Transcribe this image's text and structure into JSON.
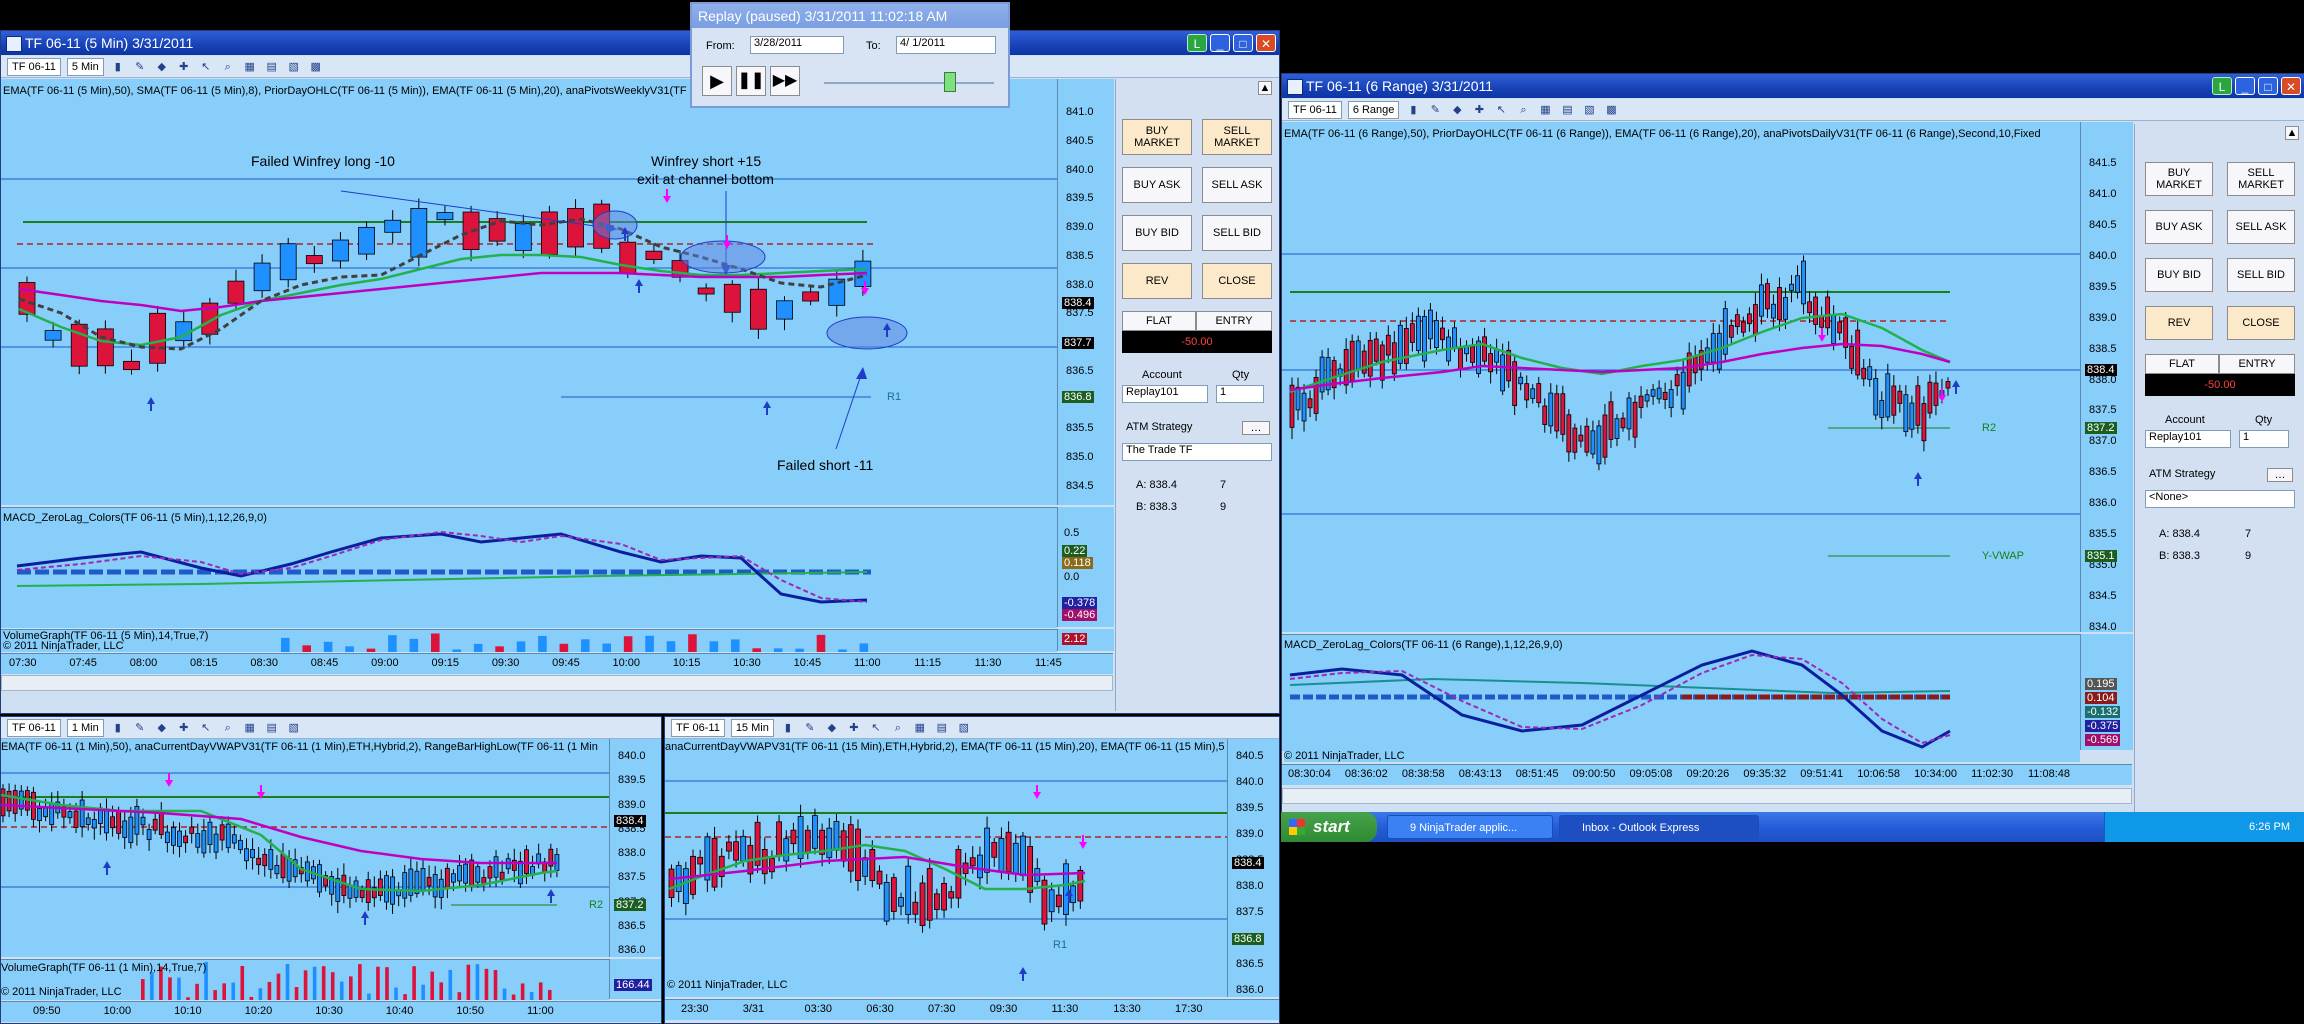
{
  "replay": {
    "title": "Replay (paused) 3/31/2011 11:02:18 AM",
    "from_label": "From:",
    "from_value": "3/28/2011",
    "to_label": "To:",
    "to_value": "4/ 1/2011"
  },
  "w1": {
    "title": "TF 06-11 (5 Min)  3/31/2011",
    "instrument": "TF 06-11",
    "period": "5 Min",
    "indicators": "EMA(TF 06-11 (5 Min),50), SMA(TF 06-11 (5 Min),8), PriorDayOHLC(TF 06-11 (5 Min)), EMA(TF 06-11 (5 Min),20), anaPivotsWeeklyV31(TF",
    "ann_failed_long": "Failed Winfrey long -10",
    "ann_short_1": "Winfrey short +15",
    "ann_short_2": "exit at channel bottom",
    "ann_failed_short": "Failed short -11",
    "r1": "R1",
    "price_ticks": [
      "841.0",
      "840.5",
      "840.0",
      "839.5",
      "839.0",
      "838.5",
      "838.0",
      "837.5",
      "837.0",
      "836.5",
      "836.0",
      "835.5",
      "835.0",
      "834.5"
    ],
    "price_boxes": [
      "838.4",
      "837.7",
      "836.8"
    ],
    "macd_label": "MACD_ZeroLag_Colors(TF 06-11 (5 Min),1,12,26,9,0)",
    "macd_ticks": [
      "0.5",
      "0.22",
      "0.118",
      "0.0",
      "-0.378",
      "-0.496"
    ],
    "volume_label": "VolumeGraph(TF 06-11 (5 Min),14,True,7)",
    "copyright": "© 2011 NinjaTrader, LLC",
    "vol_box": "2.12",
    "time_ticks": [
      "07:30",
      "07:45",
      "08:00",
      "08:15",
      "08:30",
      "08:45",
      "09:00",
      "09:15",
      "09:30",
      "09:45",
      "10:00",
      "10:15",
      "10:30",
      "10:45",
      "11:00",
      "11:15",
      "11:30",
      "11:45"
    ]
  },
  "w2": {
    "title": "TF 06-11 (6 Range)  3/31/2011",
    "instrument": "TF 06-11",
    "period": "6 Range",
    "indicators": "EMA(TF 06-11 (6 Range),50), PriorDayOHLC(TF 06-11 (6 Range)), EMA(TF 06-11 (6 Range),20), anaPivotsDailyV31(TF 06-11 (6 Range),Second,10,Fixed",
    "r2": "R2",
    "yvwap": "Y-VWAP",
    "price_ticks": [
      "841.5",
      "841.0",
      "840.5",
      "840.0",
      "839.5",
      "839.0",
      "838.5",
      "838.0",
      "837.5",
      "837.0",
      "836.5",
      "836.0",
      "835.5",
      "835.0",
      "834.5",
      "834.0"
    ],
    "price_boxes": [
      "838.4",
      "837.2",
      "835.1"
    ],
    "macd_label": "MACD_ZeroLag_Colors(TF 06-11 (6 Range),1,12,26,9,0)",
    "macd_ticks": [
      "0.195",
      "0.104",
      "-0.132",
      "-0.375",
      "-0.569"
    ],
    "copyright": "© 2011 NinjaTrader, LLC",
    "time_ticks": [
      "08:30:04",
      "08:36:02",
      "08:38:58",
      "08:43:13",
      "08:51:45",
      "09:00:50",
      "09:05:08",
      "09:20:26",
      "09:35:32",
      "09:51:41",
      "10:06:58",
      "10:34:00",
      "11:02:30",
      "11:08:48"
    ]
  },
  "w3": {
    "instrument": "TF 06-11",
    "period": "1 Min",
    "indicators": "EMA(TF 06-11 (1 Min),50), anaCurrentDayVWAPV31(TF 06-11 (1 Min),ETH,Hybrid,2), RangeBarHighLow(TF 06-11 (1 Min",
    "r2": "R2",
    "price_ticks": [
      "840.0",
      "839.5",
      "839.0",
      "838.5",
      "838.0",
      "837.5",
      "837.0",
      "836.5",
      "836.0"
    ],
    "price_boxes": [
      "838.4",
      "837.2"
    ],
    "volume_label": "VolumeGraph(TF 06-11 (1 Min),14,True,7)",
    "copyright": "© 2011 NinjaTrader, LLC",
    "vol_box": "166.44",
    "time_ticks": [
      "09:50",
      "10:00",
      "10:10",
      "10:20",
      "10:30",
      "10:40",
      "10:50",
      "11:00"
    ]
  },
  "w4": {
    "instrument": "TF 06-11",
    "period": "15 Min",
    "indicators": "anaCurrentDayVWAPV31(TF 06-11 (15 Min),ETH,Hybrid,2), EMA(TF 06-11 (15 Min),20), EMA(TF 06-11 (15 Min),5",
    "r1": "R1",
    "price_ticks": [
      "840.5",
      "840.0",
      "839.5",
      "839.0",
      "838.5",
      "838.0",
      "837.5",
      "837.0",
      "836.5",
      "836.0"
    ],
    "price_boxes": [
      "838.4",
      "836.8"
    ],
    "copyright": "© 2011 NinjaTrader, LLC",
    "time_ticks": [
      "23:30",
      "3/31",
      "03:30",
      "06:30",
      "07:30",
      "09:30",
      "11:30",
      "13:30",
      "17:30"
    ]
  },
  "panel1": {
    "buy_market": "BUY MARKET",
    "sell_market": "SELL MARKET",
    "buy_ask": "BUY ASK",
    "sell_ask": "SELL ASK",
    "buy_bid": "BUY BID",
    "sell_bid": "SELL BID",
    "rev": "REV",
    "close": "CLOSE",
    "flat": "FLAT",
    "entry": "ENTRY",
    "pnl": "-50.00",
    "account_label": "Account",
    "qty_label": "Qty",
    "account": "Replay101",
    "qty": "1",
    "atm_label": "ATM Strategy",
    "atm": "The Trade TF",
    "ask": "A: 838.4",
    "ask_size": "7",
    "bid": "B: 838.3",
    "bid_size": "9"
  },
  "panel2": {
    "buy_market": "BUY MARKET",
    "sell_market": "SELL MARKET",
    "buy_ask": "BUY ASK",
    "sell_ask": "SELL ASK",
    "buy_bid": "BUY BID",
    "sell_bid": "SELL BID",
    "rev": "REV",
    "close": "CLOSE",
    "flat": "FLAT",
    "entry": "ENTRY",
    "pnl": "-50.00",
    "account_label": "Account",
    "qty_label": "Qty",
    "account": "Replay101",
    "qty": "1",
    "atm_label": "ATM Strategy",
    "atm": "<None>",
    "ask": "A: 838.4",
    "ask_size": "7",
    "bid": "B: 838.3",
    "bid_size": "9"
  },
  "taskbar": {
    "start": "start",
    "item1": "9 NinjaTrader applic...",
    "item2": "Inbox - Outlook Express",
    "clock": "6:26 PM"
  },
  "colors": {
    "chart_bg": "#87cefa",
    "up_candle": "#1e90ff",
    "down_candle": "#dc143c",
    "ema_green": "#22b14c",
    "ema_magenta": "#c000c0",
    "sma_dashed": "#404040",
    "prior_dashed": "#b22222",
    "macd_line": "#0a1fa0"
  }
}
